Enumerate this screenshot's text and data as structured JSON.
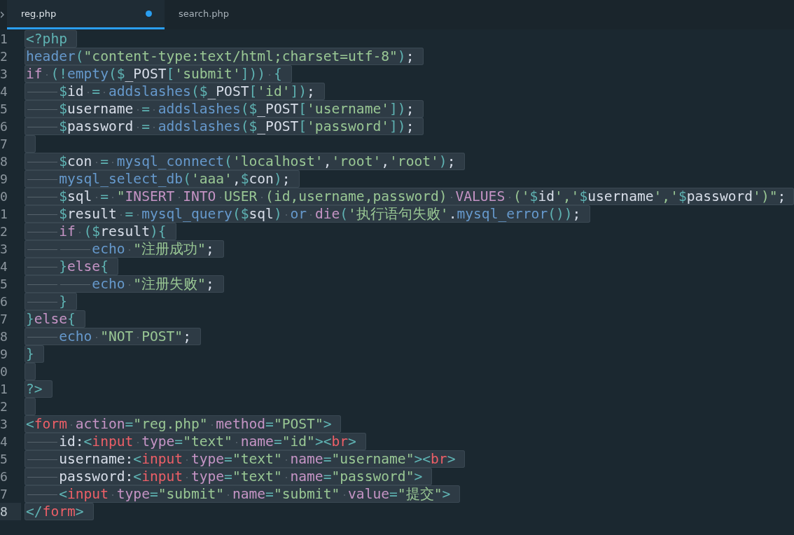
{
  "tabs": [
    {
      "label": "reg.php",
      "selected": true,
      "modified": true
    },
    {
      "label": "search.php",
      "selected": false,
      "modified": false
    }
  ],
  "editor": {
    "lines": [
      {
        "number": "1",
        "selected": true,
        "current": false,
        "tokens": [
          {
            "kind": "punct",
            "text": "<?php"
          }
        ]
      },
      {
        "number": "2",
        "selected": true,
        "current": false,
        "tokens": [
          {
            "kind": "func",
            "text": "header"
          },
          {
            "kind": "punct",
            "text": "("
          },
          {
            "kind": "string",
            "text": "\"content-type:text/html;charset=utf-8\""
          },
          {
            "kind": "punct",
            "text": ")"
          },
          {
            "kind": "plain",
            "text": ";"
          }
        ]
      },
      {
        "number": "3",
        "selected": true,
        "current": false,
        "tokens": [
          {
            "kind": "keyword",
            "text": "if "
          },
          {
            "kind": "punct",
            "text": "(!"
          },
          {
            "kind": "func",
            "text": "empty"
          },
          {
            "kind": "punct",
            "text": "($"
          },
          {
            "kind": "plain",
            "text": "_POST"
          },
          {
            "kind": "punct",
            "text": "["
          },
          {
            "kind": "string",
            "text": "'submit'"
          },
          {
            "kind": "punct",
            "text": "])) {"
          }
        ]
      },
      {
        "number": "4",
        "selected": true,
        "current": false,
        "tokens": [
          {
            "kind": "punct",
            "text": "\t$"
          },
          {
            "kind": "plain",
            "text": "id "
          },
          {
            "kind": "punct",
            "text": "= "
          },
          {
            "kind": "func",
            "text": "addslashes"
          },
          {
            "kind": "punct",
            "text": "($"
          },
          {
            "kind": "plain",
            "text": "_POST"
          },
          {
            "kind": "punct",
            "text": "["
          },
          {
            "kind": "string",
            "text": "'id'"
          },
          {
            "kind": "punct",
            "text": "])"
          },
          {
            "kind": "plain",
            "text": ";"
          }
        ]
      },
      {
        "number": "5",
        "selected": true,
        "current": false,
        "tokens": [
          {
            "kind": "punct",
            "text": "\t$"
          },
          {
            "kind": "plain",
            "text": "username "
          },
          {
            "kind": "punct",
            "text": "= "
          },
          {
            "kind": "func",
            "text": "addslashes"
          },
          {
            "kind": "punct",
            "text": "($"
          },
          {
            "kind": "plain",
            "text": "_POST"
          },
          {
            "kind": "punct",
            "text": "["
          },
          {
            "kind": "string",
            "text": "'username'"
          },
          {
            "kind": "punct",
            "text": "])"
          },
          {
            "kind": "plain",
            "text": ";"
          }
        ]
      },
      {
        "number": "6",
        "selected": true,
        "current": false,
        "tokens": [
          {
            "kind": "punct",
            "text": "\t$"
          },
          {
            "kind": "plain",
            "text": "password "
          },
          {
            "kind": "punct",
            "text": "= "
          },
          {
            "kind": "func",
            "text": "addslashes"
          },
          {
            "kind": "punct",
            "text": "($"
          },
          {
            "kind": "plain",
            "text": "_POST"
          },
          {
            "kind": "punct",
            "text": "["
          },
          {
            "kind": "string",
            "text": "'password'"
          },
          {
            "kind": "punct",
            "text": "])"
          },
          {
            "kind": "plain",
            "text": ";"
          }
        ]
      },
      {
        "number": "7",
        "selected": true,
        "current": false
      },
      {
        "number": "8",
        "selected": true,
        "current": false,
        "tokens": [
          {
            "kind": "punct",
            "text": "\t$"
          },
          {
            "kind": "plain",
            "text": "con "
          },
          {
            "kind": "punct",
            "text": "= "
          },
          {
            "kind": "func",
            "text": "mysql_connect"
          },
          {
            "kind": "punct",
            "text": "("
          },
          {
            "kind": "string",
            "text": "'localhost'"
          },
          {
            "kind": "plain",
            "text": ","
          },
          {
            "kind": "string",
            "text": "'root'"
          },
          {
            "kind": "plain",
            "text": ","
          },
          {
            "kind": "string",
            "text": "'root'"
          },
          {
            "kind": "punct",
            "text": ")"
          },
          {
            "kind": "plain",
            "text": ";"
          }
        ]
      },
      {
        "number": "9",
        "selected": true,
        "current": false,
        "tokens": [
          {
            "kind": "func",
            "text": "\tmysql_select_db"
          },
          {
            "kind": "punct",
            "text": "("
          },
          {
            "kind": "string",
            "text": "'aaa'"
          },
          {
            "kind": "plain",
            "text": ","
          },
          {
            "kind": "punct",
            "text": "$"
          },
          {
            "kind": "plain",
            "text": "con"
          },
          {
            "kind": "punct",
            "text": ")"
          },
          {
            "kind": "plain",
            "text": ";"
          }
        ]
      },
      {
        "number": "0",
        "selected": true,
        "current": false,
        "tokens": [
          {
            "kind": "punct",
            "text": "\t$"
          },
          {
            "kind": "plain",
            "text": "sql "
          },
          {
            "kind": "punct",
            "text": "= "
          },
          {
            "kind": "string",
            "text": "\""
          },
          {
            "kind": "keyword",
            "text": "INSERT "
          },
          {
            "kind": "keyword",
            "text": "INTO"
          },
          {
            "kind": "string",
            "text": " USER (id,username,password) "
          },
          {
            "kind": "keyword",
            "text": "VALUES"
          },
          {
            "kind": "string",
            "text": " ('"
          },
          {
            "kind": "punct",
            "text": "$"
          },
          {
            "kind": "plain",
            "text": "id"
          },
          {
            "kind": "string",
            "text": "','"
          },
          {
            "kind": "punct",
            "text": "$"
          },
          {
            "kind": "plain",
            "text": "username"
          },
          {
            "kind": "string",
            "text": "','"
          },
          {
            "kind": "punct",
            "text": "$"
          },
          {
            "kind": "plain",
            "text": "password"
          },
          {
            "kind": "string",
            "text": "')\""
          },
          {
            "kind": "plain",
            "text": ";"
          }
        ]
      },
      {
        "number": "1",
        "selected": true,
        "current": false,
        "tokens": [
          {
            "kind": "punct",
            "text": "\t$"
          },
          {
            "kind": "plain",
            "text": "result "
          },
          {
            "kind": "punct",
            "text": "= "
          },
          {
            "kind": "func",
            "text": "mysql_query"
          },
          {
            "kind": "punct",
            "text": "($"
          },
          {
            "kind": "plain",
            "text": "sql"
          },
          {
            "kind": "punct",
            "text": ") "
          },
          {
            "kind": "func",
            "text": "or "
          },
          {
            "kind": "keyword",
            "text": "die"
          },
          {
            "kind": "punct",
            "text": "("
          },
          {
            "kind": "string",
            "text": "'执行语句失败'"
          },
          {
            "kind": "plain",
            "text": "."
          },
          {
            "kind": "func",
            "text": "mysql_error"
          },
          {
            "kind": "punct",
            "text": "())"
          },
          {
            "kind": "plain",
            "text": ";"
          }
        ]
      },
      {
        "number": "2",
        "selected": true,
        "current": false,
        "tokens": [
          {
            "kind": "keyword",
            "text": "\tif "
          },
          {
            "kind": "punct",
            "text": "($"
          },
          {
            "kind": "plain",
            "text": "result"
          },
          {
            "kind": "punct",
            "text": "){"
          }
        ]
      },
      {
        "number": "3",
        "selected": true,
        "current": false,
        "tokens": [
          {
            "kind": "func",
            "text": "\t\techo "
          },
          {
            "kind": "string",
            "text": "\"注册成功\""
          },
          {
            "kind": "plain",
            "text": ";"
          }
        ]
      },
      {
        "number": "4",
        "selected": true,
        "current": false,
        "tokens": [
          {
            "kind": "punct",
            "text": "\t}"
          },
          {
            "kind": "keyword",
            "text": "else"
          },
          {
            "kind": "punct",
            "text": "{"
          }
        ]
      },
      {
        "number": "5",
        "selected": true,
        "current": false,
        "tokens": [
          {
            "kind": "func",
            "text": "\t\techo "
          },
          {
            "kind": "string",
            "text": "\"注册失败\""
          },
          {
            "kind": "plain",
            "text": ";"
          }
        ]
      },
      {
        "number": "6",
        "selected": true,
        "current": false,
        "tokens": [
          {
            "kind": "punct",
            "text": "\t}"
          }
        ]
      },
      {
        "number": "7",
        "selected": true,
        "current": false,
        "tokens": [
          {
            "kind": "punct",
            "text": "}"
          },
          {
            "kind": "keyword",
            "text": "else"
          },
          {
            "kind": "punct",
            "text": "{"
          }
        ]
      },
      {
        "number": "8",
        "selected": true,
        "current": false,
        "tokens": [
          {
            "kind": "func",
            "text": "\techo "
          },
          {
            "kind": "string",
            "text": "\"NOT POST\""
          },
          {
            "kind": "plain",
            "text": ";"
          }
        ]
      },
      {
        "number": "9",
        "selected": true,
        "current": false,
        "tokens": [
          {
            "kind": "punct",
            "text": "}"
          }
        ]
      },
      {
        "number": "0",
        "selected": true,
        "current": false
      },
      {
        "number": "1",
        "selected": true,
        "current": false,
        "tokens": [
          {
            "kind": "punct",
            "text": "?>"
          }
        ]
      },
      {
        "number": "2",
        "selected": true,
        "current": false
      },
      {
        "number": "3",
        "selected": true,
        "current": false,
        "tokens": [
          {
            "kind": "punct",
            "text": "<"
          },
          {
            "kind": "tag",
            "text": "form "
          },
          {
            "kind": "keyword",
            "text": "action"
          },
          {
            "kind": "punct",
            "text": "="
          },
          {
            "kind": "string",
            "text": "\"reg.php\" "
          },
          {
            "kind": "keyword",
            "text": "method"
          },
          {
            "kind": "punct",
            "text": "="
          },
          {
            "kind": "string",
            "text": "\"POST\""
          },
          {
            "kind": "punct",
            "text": ">"
          }
        ]
      },
      {
        "number": "4",
        "selected": true,
        "current": false,
        "tokens": [
          {
            "kind": "plain",
            "text": "\tid:"
          },
          {
            "kind": "punct",
            "text": "<"
          },
          {
            "kind": "tag",
            "text": "input "
          },
          {
            "kind": "keyword",
            "text": "type"
          },
          {
            "kind": "punct",
            "text": "="
          },
          {
            "kind": "string",
            "text": "\"text\" "
          },
          {
            "kind": "keyword",
            "text": "name"
          },
          {
            "kind": "punct",
            "text": "="
          },
          {
            "kind": "string",
            "text": "\"id\""
          },
          {
            "kind": "punct",
            "text": "><"
          },
          {
            "kind": "tag",
            "text": "br"
          },
          {
            "kind": "punct",
            "text": ">"
          }
        ]
      },
      {
        "number": "5",
        "selected": true,
        "current": false,
        "tokens": [
          {
            "kind": "plain",
            "text": "\tusername:"
          },
          {
            "kind": "punct",
            "text": "<"
          },
          {
            "kind": "tag",
            "text": "input "
          },
          {
            "kind": "keyword",
            "text": "type"
          },
          {
            "kind": "punct",
            "text": "="
          },
          {
            "kind": "string",
            "text": "\"text\" "
          },
          {
            "kind": "keyword",
            "text": "name"
          },
          {
            "kind": "punct",
            "text": "="
          },
          {
            "kind": "string",
            "text": "\"username\""
          },
          {
            "kind": "punct",
            "text": "><"
          },
          {
            "kind": "tag",
            "text": "br"
          },
          {
            "kind": "punct",
            "text": ">"
          }
        ]
      },
      {
        "number": "6",
        "selected": true,
        "current": false,
        "tokens": [
          {
            "kind": "plain",
            "text": "\tpassword:"
          },
          {
            "kind": "punct",
            "text": "<"
          },
          {
            "kind": "tag",
            "text": "input "
          },
          {
            "kind": "keyword",
            "text": "type"
          },
          {
            "kind": "punct",
            "text": "="
          },
          {
            "kind": "string",
            "text": "\"text\" "
          },
          {
            "kind": "keyword",
            "text": "name"
          },
          {
            "kind": "punct",
            "text": "="
          },
          {
            "kind": "string",
            "text": "\"password\""
          },
          {
            "kind": "punct",
            "text": ">"
          }
        ]
      },
      {
        "number": "7",
        "selected": true,
        "current": false,
        "tokens": [
          {
            "kind": "punct",
            "text": "\t<"
          },
          {
            "kind": "tag",
            "text": "input "
          },
          {
            "kind": "keyword",
            "text": "type"
          },
          {
            "kind": "punct",
            "text": "="
          },
          {
            "kind": "string",
            "text": "\"submit\" "
          },
          {
            "kind": "keyword",
            "text": "name"
          },
          {
            "kind": "punct",
            "text": "="
          },
          {
            "kind": "string",
            "text": "\"submit\" "
          },
          {
            "kind": "keyword",
            "text": "value"
          },
          {
            "kind": "punct",
            "text": "="
          },
          {
            "kind": "string",
            "text": "\"提交\""
          },
          {
            "kind": "punct",
            "text": ">"
          }
        ]
      },
      {
        "number": "8",
        "selected": true,
        "current": true,
        "tokens": [
          {
            "kind": "punct",
            "text": "</"
          },
          {
            "kind": "tag",
            "text": "form"
          },
          {
            "kind": "punct",
            "text": ">"
          }
        ]
      }
    ]
  }
}
